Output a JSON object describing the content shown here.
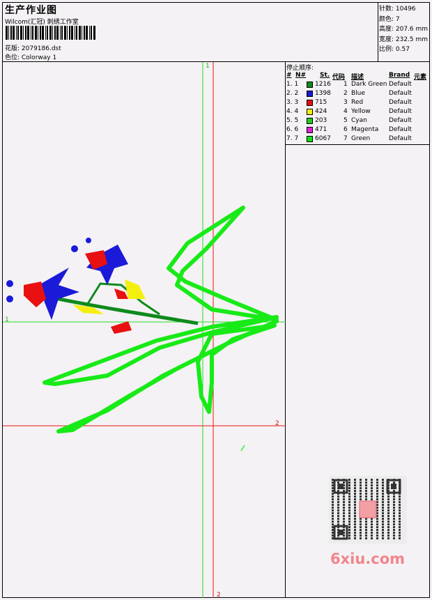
{
  "header": {
    "title": "生产作业图",
    "subtitle": "Wilcom(汇冠) 刺绣工作室",
    "design_label": "花版: 2079186.dst",
    "colorway_label": "色位: Colorway 1"
  },
  "stats": {
    "stitches": "针数: 10496",
    "colors": "颜色: 7",
    "height": "高度: 207.6 mm",
    "width": "宽度: 232.5 mm",
    "scale": "比例: 0.57"
  },
  "sequence": {
    "title": "停止顺序:",
    "headers": [
      "#",
      "N#",
      "St.",
      "代码",
      "描述",
      "Brand",
      "元素"
    ],
    "rows": [
      {
        "index": "1. 1",
        "color": "#0e8a1c",
        "st": "1216",
        "code": "1",
        "desc": "Dark Green",
        "brand": "Default"
      },
      {
        "index": "2. 2",
        "color": "#1a1ad8",
        "st": "1398",
        "code": "2",
        "desc": "Blue",
        "brand": "Default"
      },
      {
        "index": "3. 3",
        "color": "#e81010",
        "st": "715",
        "code": "3",
        "desc": "Red",
        "brand": "Default"
      },
      {
        "index": "4. 4",
        "color": "#f5ef10",
        "st": "424",
        "code": "4",
        "desc": "Yellow",
        "brand": "Default"
      },
      {
        "index": "5. 5",
        "color": "#22cc22",
        "st": "203",
        "code": "5",
        "desc": "Cyan",
        "brand": "Default"
      },
      {
        "index": "6. 6",
        "color": "#e020d8",
        "st": "471",
        "code": "6",
        "desc": "Magenta",
        "brand": "Default"
      },
      {
        "index": "7. 7",
        "color": "#10e010",
        "st": "6067",
        "code": "7",
        "desc": "Green",
        "brand": "Default"
      }
    ]
  },
  "plot": {
    "guide_labels": [
      "1",
      "1",
      "2",
      "2"
    ]
  },
  "watermark": {
    "logo_text": "6xiu.com"
  }
}
